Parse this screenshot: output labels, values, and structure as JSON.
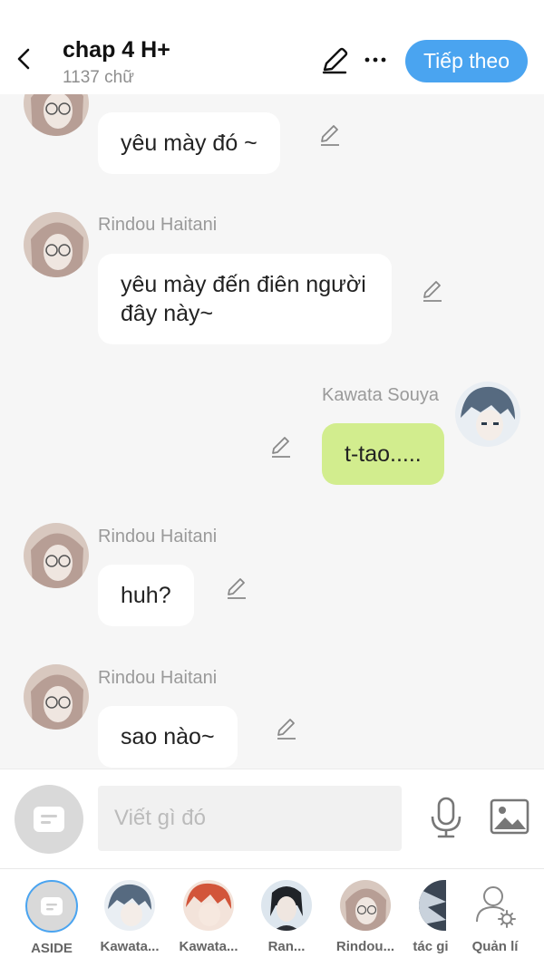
{
  "header": {
    "title": "chap 4 H+",
    "word_count": "1137 chữ",
    "next_label": "Tiếp theo"
  },
  "messages": [
    {
      "sender": "",
      "text": "yêu mày đó ~",
      "side": "left"
    },
    {
      "sender": "Rindou Haitani",
      "text": "yêu mày đến điên người đây này~",
      "side": "left"
    },
    {
      "sender": "Kawata Souya",
      "text": "t-tao.....",
      "side": "right"
    },
    {
      "sender": "Rindou Haitani",
      "text": "huh?",
      "side": "left"
    },
    {
      "sender": "Rindou Haitani",
      "text": "sao nào~",
      "side": "left"
    }
  ],
  "composer": {
    "placeholder": "Viết gì đó"
  },
  "characters": [
    {
      "label": "ASIDE"
    },
    {
      "label": "Kawata..."
    },
    {
      "label": "Kawata..."
    },
    {
      "label": "Ran..."
    },
    {
      "label": "Rindou..."
    },
    {
      "label": "tác gi"
    },
    {
      "label": "Quản lí"
    }
  ],
  "colors": {
    "accent": "#4aa4f0",
    "my_bubble": "#d2ed8e",
    "bubble": "#ffffff",
    "background": "#f6f6f6"
  }
}
